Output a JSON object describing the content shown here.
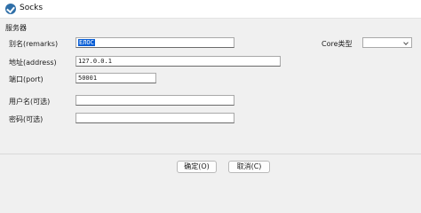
{
  "window": {
    "title": "Socks"
  },
  "group": {
    "label": "服务器"
  },
  "form": {
    "remarks_label": "别名(remarks)",
    "remarks_value": "ЕЛОС",
    "address_label": "地址(address)",
    "address_value": "127.0.0.1",
    "port_label": "端口(port)",
    "port_value": "50001",
    "username_label": "用户名(可选)",
    "username_value": "",
    "password_label": "密码(可选)",
    "password_value": "",
    "core_type_label": "Core类型",
    "core_type_value": ""
  },
  "buttons": {
    "ok": "确定(O)",
    "cancel": "取消(C)"
  }
}
